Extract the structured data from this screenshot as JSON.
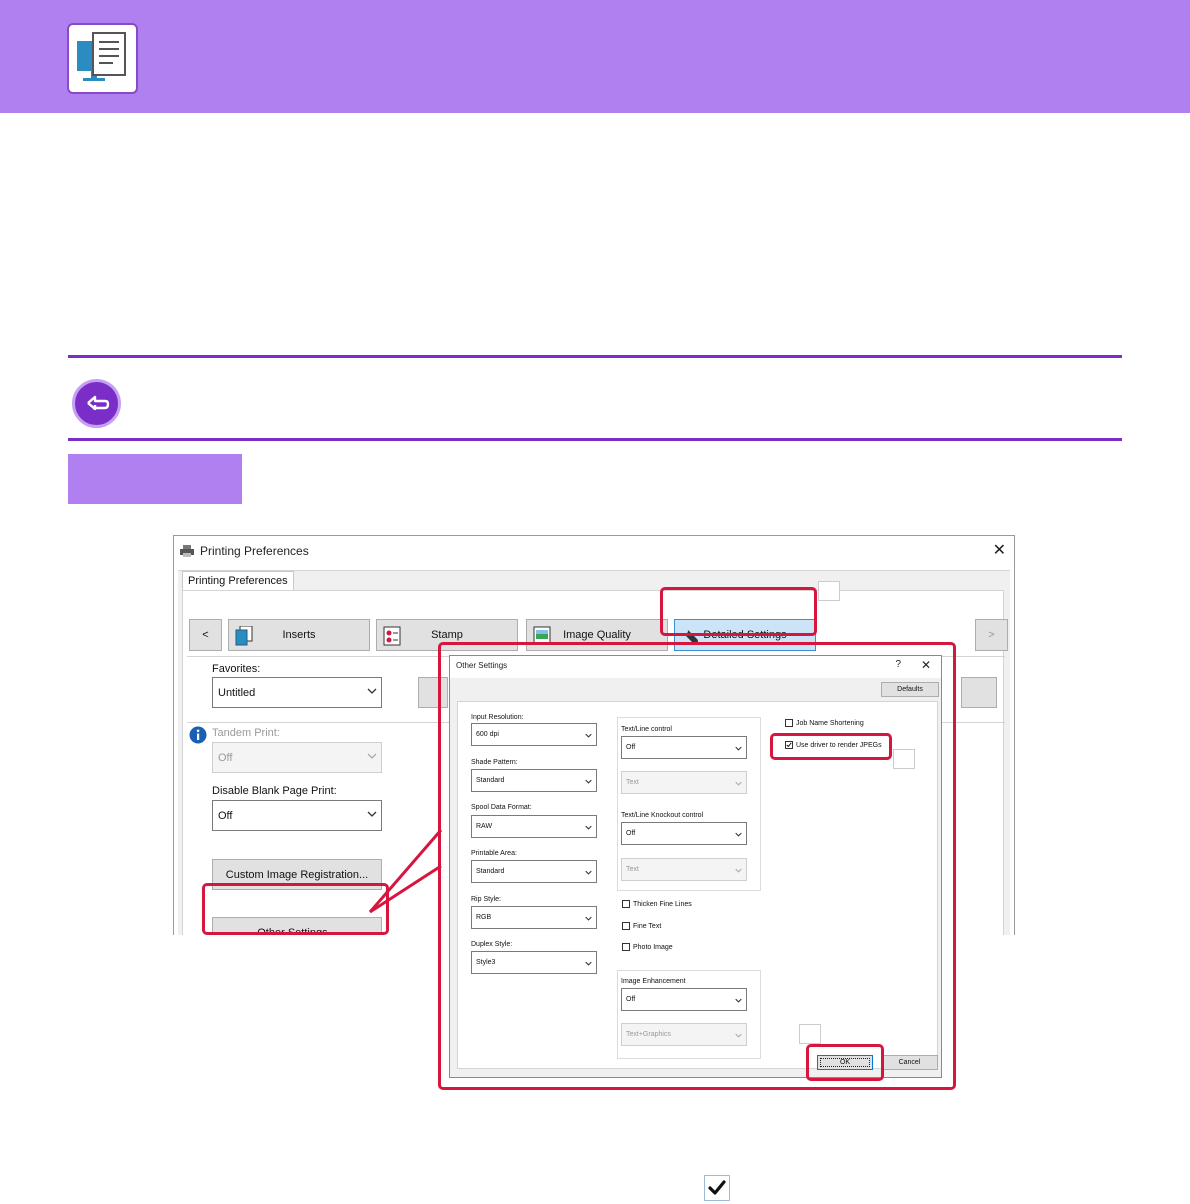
{
  "window": {
    "title": "Printing Preferences",
    "close_glyph": "✕",
    "tab_label": "Printing Preferences",
    "ribbon": {
      "prev_glyph": "<",
      "next_glyph": ">",
      "items": [
        {
          "label": "Inserts"
        },
        {
          "label": "Stamp"
        },
        {
          "label": "Image Quality"
        },
        {
          "label": "Detailed Settings"
        }
      ]
    },
    "favorites": {
      "label": "Favorites:",
      "value": "Untitled"
    },
    "tandem_print": {
      "label": "Tandem Print:",
      "value": "Off"
    },
    "disable_blank_page": {
      "label": "Disable Blank Page Print:",
      "value": "Off"
    },
    "custom_image_button": "Custom Image Registration...",
    "other_settings_button": "Other Settings..."
  },
  "dialog": {
    "title": "Other Settings",
    "help_glyph": "?",
    "close_glyph": "✕",
    "defaults_button": "Defaults",
    "input_resolution": {
      "label": "Input Resolution:",
      "value": "600 dpi"
    },
    "shade_pattern": {
      "label": "Shade Pattern:",
      "value": "Standard"
    },
    "spool_data_format": {
      "label": "Spool Data Format:",
      "value": "RAW"
    },
    "printable_area": {
      "label": "Printable Area:",
      "value": "Standard"
    },
    "rip_style": {
      "label": "Rip Style:",
      "value": "RGB"
    },
    "duplex_style": {
      "label": "Duplex Style:",
      "value": "Style3"
    },
    "text_line_control": {
      "label": "Text/Line control",
      "value": "Off",
      "sub_value": "Text"
    },
    "text_line_knockout": {
      "label": "Text/Line Knockout control",
      "value": "Off",
      "sub_value": "Text"
    },
    "thicken_fine_lines": {
      "label": "Thicken Fine Lines",
      "checked": false
    },
    "fine_text": {
      "label": "Fine Text",
      "checked": false
    },
    "photo_image": {
      "label": "Photo Image",
      "checked": false
    },
    "image_enhancement": {
      "label": "Image Enhancement",
      "value": "Off",
      "sub_value": "Text+Graphics"
    },
    "job_name_shortening": {
      "label": "Job Name Shortening",
      "checked": false
    },
    "use_driver_jpeg": {
      "label": "Use driver to render JPEGs",
      "checked": true
    },
    "ok_button": "OK",
    "cancel_button": "Cancel"
  },
  "colors": {
    "band": "#b07ff0",
    "rule": "#7b2dc8",
    "callout": "#d6163f"
  },
  "icons": [
    "monitor-document-icon",
    "return-icon",
    "printer-icon",
    "info-icon",
    "wrench-icon",
    "checkmark-icon"
  ]
}
